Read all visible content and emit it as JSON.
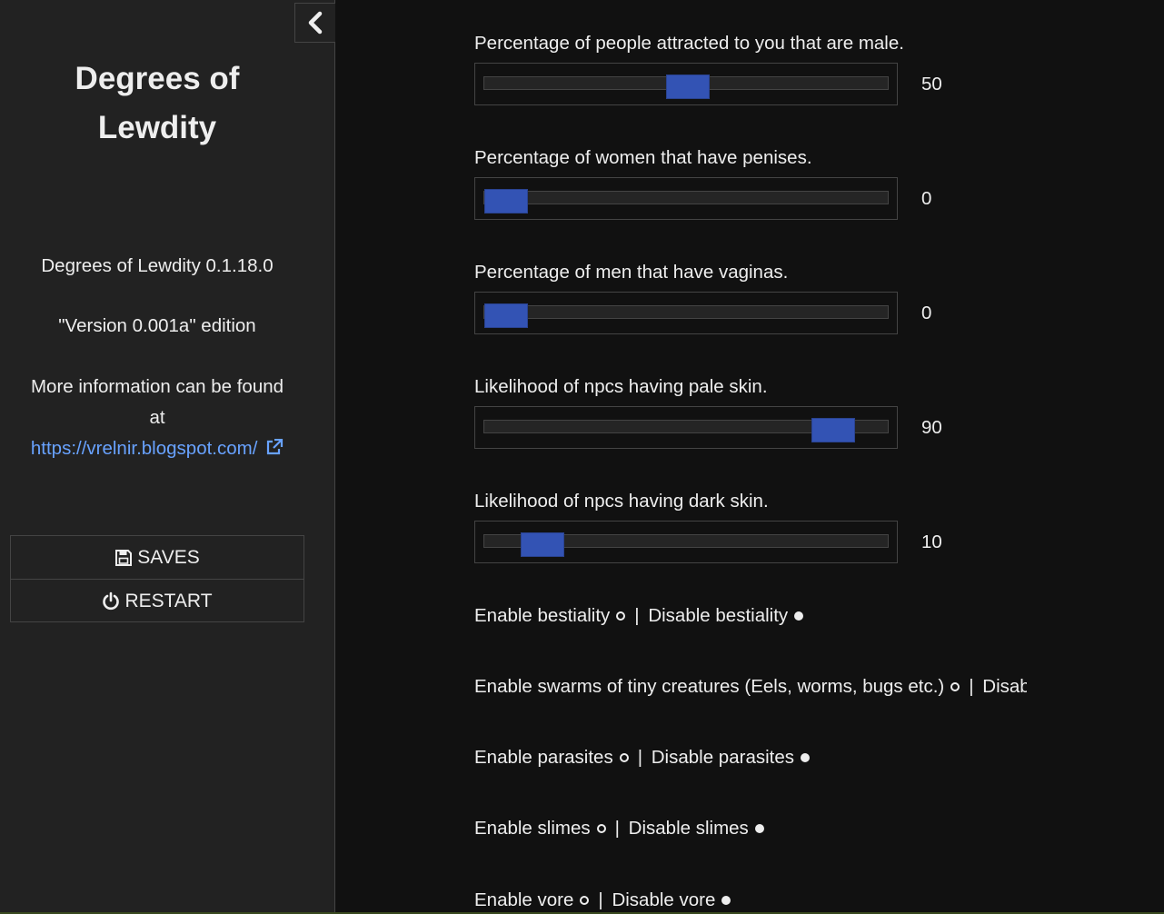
{
  "sidebar": {
    "title_line1": "Degrees of",
    "title_line2": "Lewdity",
    "version": "Degrees of Lewdity 0.1.18.0",
    "edition": "\"Version 0.001a\" edition",
    "info_line1": "More information can be found",
    "info_line2": "at",
    "link": "https://vrelnir.blogspot.com/",
    "saves_label": "SAVES",
    "restart_label": "RESTART"
  },
  "sliders": [
    {
      "label": "Percentage of people attracted to you that are male.",
      "value": "50",
      "fraction": 0.5
    },
    {
      "label": "Percentage of women that have penises.",
      "value": "0",
      "fraction": 0.0
    },
    {
      "label": "Percentage of men that have vaginas.",
      "value": "0",
      "fraction": 0.0
    },
    {
      "label": "Likelihood of npcs having pale skin.",
      "value": "90",
      "fraction": 0.9
    },
    {
      "label": "Likelihood of npcs having dark skin.",
      "value": "10",
      "fraction": 0.1
    }
  ],
  "toggles": [
    {
      "enable": "Enable bestiality",
      "disable": "Disable bestiality",
      "selected": "disable"
    },
    {
      "enable": "Enable swarms of tiny creatures (Eels, worms, bugs etc.)",
      "disable": "Disable swarms",
      "selected": "disable"
    },
    {
      "enable": "Enable parasites",
      "disable": "Disable parasites",
      "selected": "disable"
    },
    {
      "enable": "Enable slimes",
      "disable": "Disable slimes",
      "selected": "disable"
    },
    {
      "enable": "Enable vore",
      "disable": "Disable vore",
      "selected": "disable"
    }
  ],
  "separator": "|",
  "icons": {
    "stow": "chevron-left-icon",
    "link": "external-link-icon",
    "saves": "floppy-disk-icon",
    "restart": "power-icon"
  },
  "colors": {
    "background": "#111111",
    "sidebar": "#222222",
    "slider_thumb": "#3353b4",
    "link": "#68a2ff"
  }
}
